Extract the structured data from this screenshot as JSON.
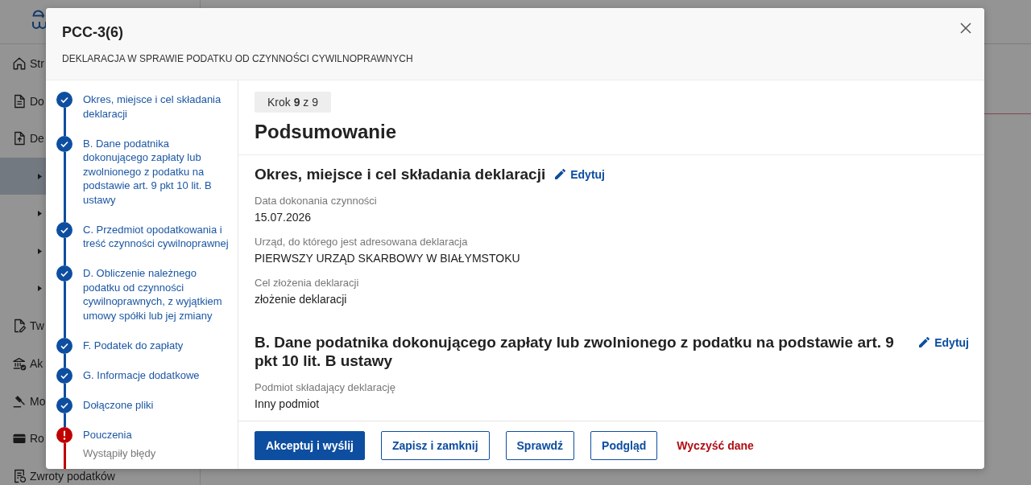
{
  "sidebar": {
    "items": [
      {
        "label": "Str"
      },
      {
        "label": "Do"
      },
      {
        "label": "De",
        "children": [
          {
            "selected": true
          },
          {
            "selected": false
          },
          {
            "selected": false
          },
          {
            "selected": false
          }
        ]
      },
      {
        "label": "Tw"
      },
      {
        "label": "Ak"
      },
      {
        "label": "Mo"
      },
      {
        "label": "Ro"
      },
      {
        "label": "Zwroty podatków"
      }
    ]
  },
  "dialog": {
    "title": "PCC-3(6)",
    "subtitle": "DEKLARACJA W SPRAWIE PODATKU OD CZYNNOŚCI CYWILNOPRAWNYCH",
    "steps": [
      {
        "label": "Okres, miejsce i cel składania deklaracji",
        "kind": "done"
      },
      {
        "label": "B. Dane podatnika dokonującego zapłaty lub zwolnionego z podatku na podstawie art. 9 pkt 10 lit. B ustawy",
        "kind": "done"
      },
      {
        "label": "C. Przedmiot opodatkowania i treść czynności cywilnoprawnej",
        "kind": "done"
      },
      {
        "label": "D. Obliczenie należnego podatku od czynności cywilnoprawnych, z wyjątkiem umowy spółki lub jej zmiany",
        "kind": "done"
      },
      {
        "label": "F. Podatek do zapłaty",
        "kind": "done"
      },
      {
        "label": "G. Informacje dodatkowe",
        "kind": "done"
      },
      {
        "label": "Dołączone pliki",
        "kind": "done"
      },
      {
        "label": "Pouczenia",
        "kind": "error",
        "note": "Wystąpiły błędy"
      }
    ],
    "step_counter": "Krok **9** z 9",
    "page_title": "Podsumowanie",
    "sections": [
      {
        "title": "Okres, miejsce i cel składania deklaracji",
        "edit_label": "Edytuj",
        "fields": [
          {
            "label": "Data dokonania czynności",
            "value": "15.07.2026"
          },
          {
            "label": "Urząd, do którego jest adresowana deklaracja",
            "value": "PIERWSZY URZĄD SKARBOWY W BIAŁYMSTOKU"
          },
          {
            "label": "Cel złożenia deklaracji",
            "value": "złożenie deklaracji"
          }
        ]
      },
      {
        "title": "B. Dane podatnika dokonującego zapłaty lub zwolnionego z podatku na podstawie art. 9 pkt 10 lit. B ustawy",
        "edit_label": "Edytuj",
        "fields": [
          {
            "label": "Podmiot składający deklarację",
            "value": "Inny podmiot"
          }
        ]
      }
    ],
    "actions": [
      {
        "label": "Akceptuj i wyślij",
        "kind": "primary"
      },
      {
        "label": "Zapisz i zamknij",
        "kind": "outline"
      },
      {
        "label": "Sprawdź",
        "kind": "outline"
      },
      {
        "label": "Podgląd",
        "kind": "outline"
      },
      {
        "label": "Wyczyść dane",
        "kind": "danger"
      }
    ]
  }
}
